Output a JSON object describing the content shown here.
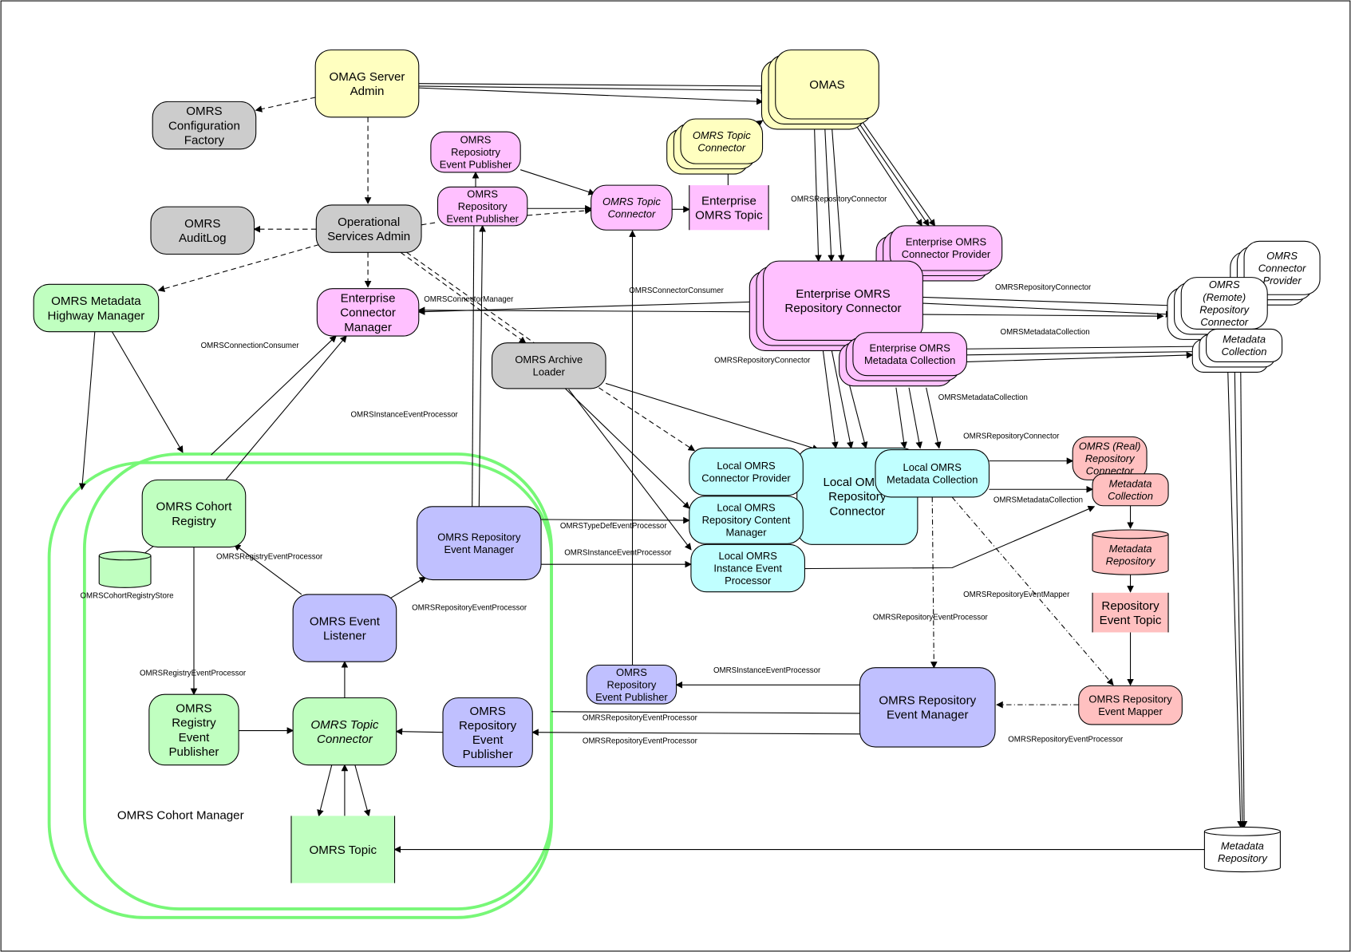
{
  "colors": {
    "yellow": "#ffffc0",
    "grey": "#cccccc",
    "pink": "#ffc0ff",
    "green": "#c0ffc0",
    "blue": "#c0c0ff",
    "cyan": "#c0ffff",
    "salmon": "#ffc0c0",
    "white": "#ffffff",
    "cohort_outline": "#77f777"
  },
  "cohort_manager_label": "OMRS Cohort Manager",
  "nodes": [
    {
      "id": "omag-server-admin",
      "lines": [
        "OMAG Server",
        "Admin"
      ],
      "color": "yellow"
    },
    {
      "id": "omrs-configuration-factory",
      "lines": [
        "OMRS",
        "Configuration",
        "Factory"
      ],
      "color": "grey"
    },
    {
      "id": "omrs-auditlog",
      "lines": [
        "OMRS",
        "AuditLog"
      ],
      "color": "grey"
    },
    {
      "id": "operational-services-admin",
      "lines": [
        "Operational",
        "Services Admin"
      ],
      "color": "grey"
    },
    {
      "id": "omrs-metadata-highway-manager",
      "lines": [
        "OMRS Metadata",
        "Highway Manager"
      ],
      "color": "green"
    },
    {
      "id": "enterprise-connector-manager",
      "lines": [
        "Enterprise",
        "Connector",
        "Manager"
      ],
      "color": "pink"
    },
    {
      "id": "omrs-reposiotry-event-publisher",
      "lines": [
        "OMRS",
        "Reposiotry",
        "Event Publisher"
      ],
      "color": "pink"
    },
    {
      "id": "omrs-repository-event-publisher-enterprise",
      "lines": [
        "OMRS",
        "Repository",
        "Event Publisher"
      ],
      "color": "pink"
    },
    {
      "id": "omrs-topic-connector-enterprise",
      "lines": [
        "OMRS Topic",
        "Connector"
      ],
      "color": "pink"
    },
    {
      "id": "enterprise-omrs-topic",
      "lines": [
        "Enterprise",
        "OMRS Topic"
      ],
      "color": "pink"
    },
    {
      "id": "omas",
      "lines": [
        "OMAS"
      ],
      "color": "yellow"
    },
    {
      "id": "omrs-topic-connector-omas",
      "lines": [
        "OMRS Topic",
        "Connector"
      ],
      "color": "yellow"
    },
    {
      "id": "omrs-archive-loader",
      "lines": [
        "OMRS Archive",
        "Loader"
      ],
      "color": "grey"
    },
    {
      "id": "enterprise-omrs-connector-provider",
      "lines": [
        "Enterprise OMRS",
        "Connector Provider"
      ],
      "color": "pink"
    },
    {
      "id": "enterprise-omrs-repository-connector",
      "lines": [
        "Enterprise OMRS",
        "Repository Connector"
      ],
      "color": "pink"
    },
    {
      "id": "enterprise-omrs-metadata-collection",
      "lines": [
        "Enterprise OMRS",
        "Metadata Collection"
      ],
      "color": "pink"
    },
    {
      "id": "omrs-connector-provider-remote",
      "lines": [
        "OMRS",
        "Connector",
        "Provider"
      ],
      "color": "white"
    },
    {
      "id": "omrs-remote-repository-connector",
      "lines": [
        "OMRS",
        "(Remote)",
        "Repository",
        "Connector"
      ],
      "color": "white"
    },
    {
      "id": "metadata-collection-remote",
      "lines": [
        "Metadata",
        "Collection"
      ],
      "color": "white"
    },
    {
      "id": "local-omrs-repository-connector",
      "lines": [
        "Local OMRS",
        "Repository",
        "Connector"
      ],
      "color": "cyan"
    },
    {
      "id": "local-omrs-connector-provider",
      "lines": [
        "Local OMRS",
        "Connector Provider"
      ],
      "color": "cyan"
    },
    {
      "id": "local-omrs-repository-content-manager",
      "lines": [
        "Local OMRS",
        "Repository Content",
        "Manager"
      ],
      "color": "cyan"
    },
    {
      "id": "local-omrs-instance-event-processor",
      "lines": [
        "Local OMRS",
        "Instance Event",
        "Processor"
      ],
      "color": "cyan"
    },
    {
      "id": "local-omrs-metadata-collection",
      "lines": [
        "Local OMRS",
        "Metadata Collection"
      ],
      "color": "cyan"
    },
    {
      "id": "omrs-real-repository-connector",
      "lines": [
        "OMRS (Real)",
        "Repository",
        "Connector"
      ],
      "color": "salmon"
    },
    {
      "id": "metadata-collection-real",
      "lines": [
        "Metadata",
        "Collection"
      ],
      "color": "salmon"
    },
    {
      "id": "metadata-repository-real",
      "lines": [
        "Metadata",
        "Repository"
      ],
      "color": "salmon"
    },
    {
      "id": "repository-event-topic",
      "lines": [
        "Repository",
        "Event Topic"
      ],
      "color": "salmon"
    },
    {
      "id": "omrs-repository-event-mapper",
      "lines": [
        "OMRS Repository",
        "Event Mapper"
      ],
      "color": "salmon"
    },
    {
      "id": "omrs-repository-event-manager-local",
      "lines": [
        "OMRS Repository",
        "Event Manager"
      ],
      "color": "blue"
    },
    {
      "id": "omrs-repository-event-publisher-local",
      "lines": [
        "OMRS",
        "Repository",
        "Event Publisher"
      ],
      "color": "blue"
    },
    {
      "id": "omrs-cohort-registry",
      "lines": [
        "OMRS Cohort",
        "Registry"
      ],
      "color": "green"
    },
    {
      "id": "omrs-cohort-registry-store",
      "lines": [],
      "color": "green"
    },
    {
      "id": "omrs-repository-event-manager-cohort",
      "lines": [
        "OMRS Repository",
        "Event Manager"
      ],
      "color": "blue"
    },
    {
      "id": "omrs-event-listener",
      "lines": [
        "OMRS Event",
        "Listener"
      ],
      "color": "blue"
    },
    {
      "id": "omrs-registry-event-publisher",
      "lines": [
        "OMRS",
        "Registry",
        "Event",
        "Publisher"
      ],
      "color": "green"
    },
    {
      "id": "omrs-topic-connector-cohort",
      "lines": [
        "OMRS Topic",
        "Connector"
      ],
      "color": "green"
    },
    {
      "id": "omrs-repository-event-publisher-cohort",
      "lines": [
        "OMRS",
        "Repository",
        "Event",
        "Publisher"
      ],
      "color": "blue"
    },
    {
      "id": "omrs-topic",
      "lines": [
        "OMRS Topic"
      ],
      "color": "green"
    },
    {
      "id": "metadata-repository-remote",
      "lines": [
        "Metadata",
        "Repository"
      ],
      "color": "white"
    }
  ],
  "edge_labels": [
    "OMRSRepositoryConnector",
    "OMRSConnectorManager",
    "OMRSConnectorConsumer",
    "OMRSConnectionConsumer",
    "OMRSInstanceEventProcessor",
    "OMRSRepositoryConnector",
    "OMRSMetadataCollection",
    "OMRSRepositoryConnector",
    "OMRSMetadataCollection",
    "OMRSRepositoryConnector",
    "OMRSMetadataCollection",
    "OMRSTypeDefEventProcessor",
    "OMRSInstanceEventProcessor",
    "OMRSRegistryEventProcessor",
    "OMRSRepositoryEventProcessor",
    "OMRSRepositoryEventMapper",
    "OMRSRepositoryEventProcessor",
    "OMRSRegistryEventProcessor",
    "OMRSInstanceEventProcessor",
    "OMRSRepositoryEventProcessor",
    "OMRSRepositoryEventProcessor",
    "OMRSRepositoryEventProcessor",
    "OMRSCohortRegistryStore"
  ]
}
